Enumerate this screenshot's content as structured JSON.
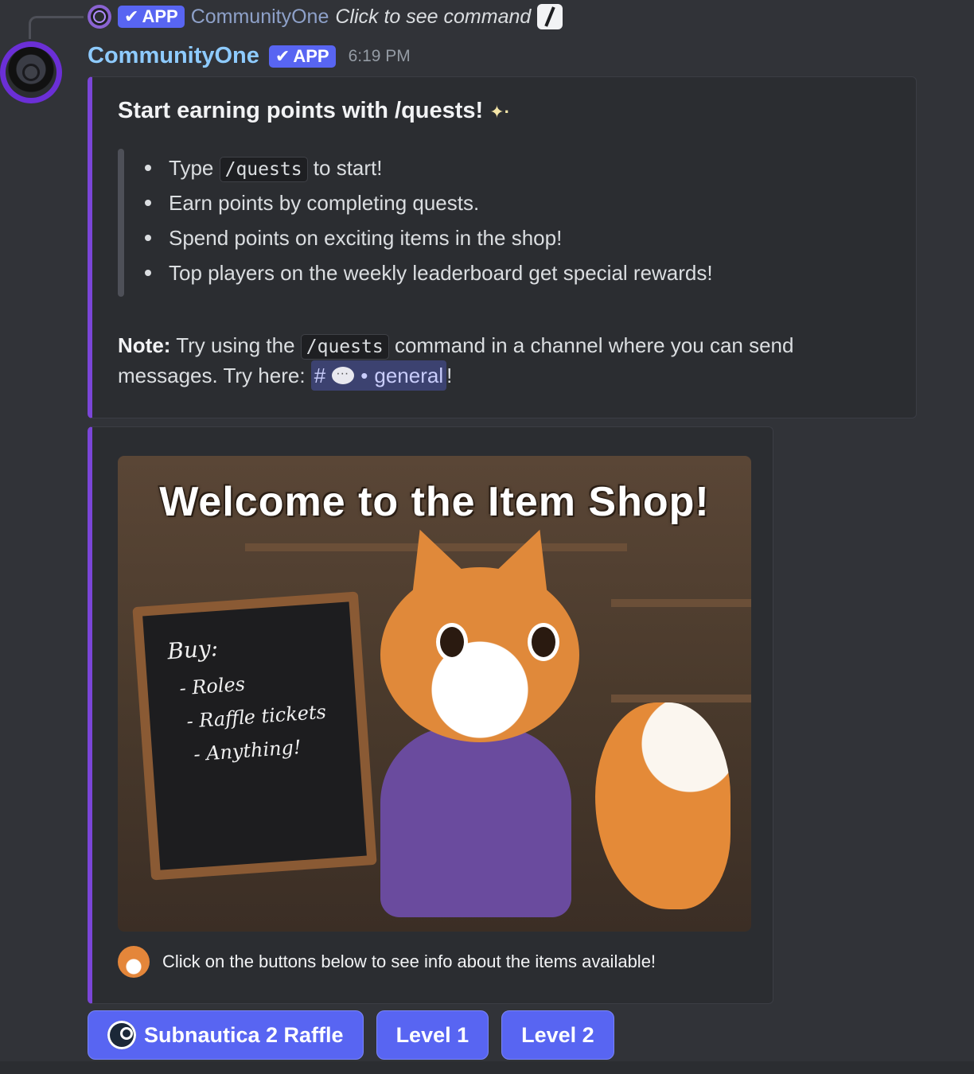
{
  "reply": {
    "app_tag": "APP",
    "author": "CommunityOne",
    "text": "Click to see command"
  },
  "message": {
    "author": "CommunityOne",
    "app_tag": "APP",
    "timestamp": "6:19 PM"
  },
  "embed1": {
    "title": "Start earning points with /quests!",
    "sparkle": "✦·",
    "bullets": {
      "b1_prefix": "Type",
      "b1_code": "/quests",
      "b1_suffix": "to start!",
      "b2": "Earn points by completing quests.",
      "b3": "Spend points on exciting items in the shop!",
      "b4": "Top players on the weekly leaderboard get special rewards!"
    },
    "note": {
      "label": "Note:",
      "part1": "Try using the",
      "code": "/quests",
      "part2": "command in a channel where you can send messages. Try here:",
      "channel_hash": "#",
      "channel_sep": "•",
      "channel_name": "general",
      "end": "!"
    }
  },
  "embed2": {
    "image_title": "Welcome to the Item Shop!",
    "board": {
      "heading": "Buy:",
      "line1": "- Roles",
      "line2": "- Raffle tickets",
      "line3": "- Anything!"
    },
    "caption": "Click on the buttons below to see info about the items available!"
  },
  "buttons": [
    {
      "label": "Subnautica 2 Raffle",
      "icon": "steam-icon"
    },
    {
      "label": "Level 1"
    },
    {
      "label": "Level 2"
    }
  ],
  "colors": {
    "accent": "#5865f2",
    "embed_border": "#7b46d8",
    "username": "#8ecbff"
  }
}
